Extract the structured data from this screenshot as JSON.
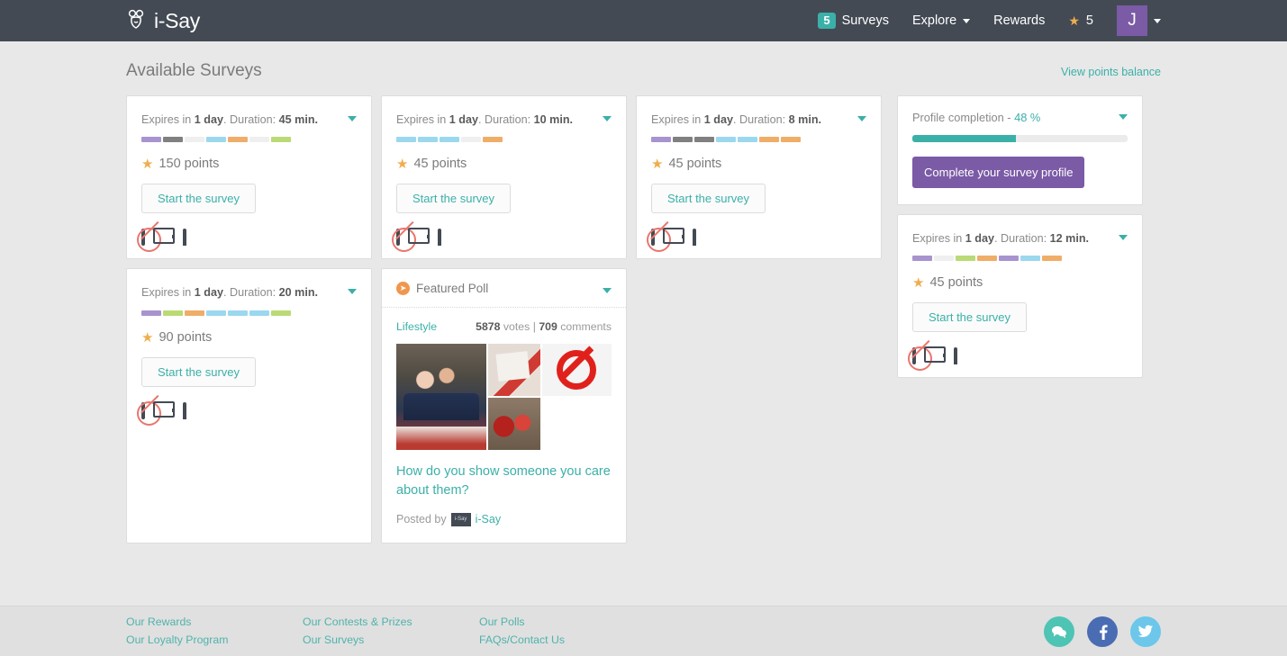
{
  "brand": {
    "name": "i-Say",
    "logo_icon": "isay-owl-logo-icon"
  },
  "nav": {
    "surveys_badge": "5",
    "surveys_label": "Surveys",
    "explore_label": "Explore",
    "rewards_label": "Rewards",
    "points_star_icon": "star-icon",
    "points_value": "5",
    "avatar_initial": "J",
    "caret_icon": "chevron-down-icon"
  },
  "page": {
    "title": "Available Surveys",
    "points_balance_link": "View points balance"
  },
  "survey_cards": [
    {
      "expires_prefix": "Expires in ",
      "expires_value": "1 day",
      "duration_prefix": ". Duration: ",
      "duration_value": "45 min.",
      "points": "150 points",
      "button": "Start the survey",
      "segments": [
        "#a794cf",
        "#808080",
        "#efefef",
        "#9bd8ef",
        "#f0ad68",
        "#efefef",
        "#bada75"
      ]
    },
    {
      "expires_prefix": "Expires in ",
      "expires_value": "1 day",
      "duration_prefix": ". Duration: ",
      "duration_value": "10 min.",
      "points": "45 points",
      "button": "Start the survey",
      "segments": [
        "#9bd8ef",
        "#9bd8ef",
        "#9bd8ef",
        "#efefef",
        "#f0ad68"
      ]
    },
    {
      "expires_prefix": "Expires in ",
      "expires_value": "1 day",
      "duration_prefix": ". Duration: ",
      "duration_value": "8 min.",
      "points": "45 points",
      "button": "Start the survey",
      "segments": [
        "#a794cf",
        "#808080",
        "#808080",
        "#9bd8ef",
        "#9bd8ef",
        "#f0ad68",
        "#f0ad68"
      ]
    },
    {
      "expires_prefix": "Expires in ",
      "expires_value": "1 day",
      "duration_prefix": ". Duration: ",
      "duration_value": "20 min.",
      "points": "90 points",
      "button": "Start the survey",
      "segments": [
        "#a794cf",
        "#bada75",
        "#f0ad68",
        "#9bd8ef",
        "#9bd8ef",
        "#9bd8ef",
        "#bada75"
      ]
    }
  ],
  "side_survey_card": {
    "expires_prefix": "Expires in ",
    "expires_value": "1 day",
    "duration_prefix": ". Duration: ",
    "duration_value": "12 min.",
    "points": "45 points",
    "button": "Start the survey",
    "segments": [
      "#a794cf",
      "#efefef",
      "#bada75",
      "#f0ad68",
      "#a794cf",
      "#9bd8ef",
      "#f0ad68"
    ]
  },
  "profile_card": {
    "label": "Profile completion - ",
    "percent_text": "48 %",
    "percent_value": 48,
    "button": "Complete your survey profile",
    "progress_color": "#3bb0a8",
    "button_color": "#7b5aa6"
  },
  "poll": {
    "header": "Featured Poll",
    "header_icon": "arrow-circle-right-icon",
    "category": "Lifestyle",
    "votes_count": "5878",
    "votes_label": " votes | ",
    "comments_count": "709",
    "comments_label": " comments",
    "question": "How do you show someone you care about them?",
    "posted_by_label": "Posted by",
    "author": "i-Say",
    "images": [
      {
        "name": "couple-dinner-photo"
      },
      {
        "name": "greeting-card-petals-photo"
      },
      {
        "name": "no-answer-option"
      },
      {
        "name": "roses-gift-photo"
      }
    ]
  },
  "device_icons": {
    "phone": "mobile-phone-not-supported-icon",
    "tablet": "tablet-icon",
    "laptop": "laptop-icon"
  },
  "footer": {
    "columns": [
      [
        "Our Rewards",
        "Our Loyalty Program"
      ],
      [
        "Our Contests & Prizes",
        "Our Surveys"
      ],
      [
        "Our Polls",
        "FAQs/Contact Us"
      ]
    ],
    "socials": [
      {
        "name": "chat-bubble-icon",
        "color": "#4ec4b4"
      },
      {
        "name": "facebook-icon",
        "color": "#4a6cb3"
      },
      {
        "name": "twitter-icon",
        "color": "#6cc7ea"
      }
    ]
  }
}
